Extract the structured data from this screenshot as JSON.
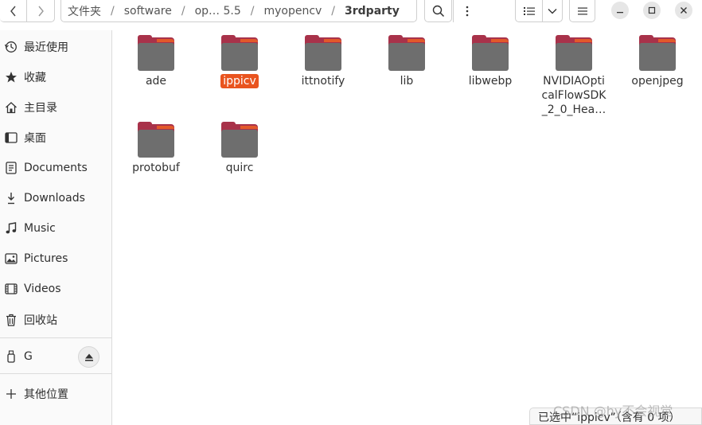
{
  "header": {
    "breadcrumbs": [
      "文件夹",
      "software",
      "op… 5.5",
      "myopencv",
      "3rdparty"
    ]
  },
  "sidebar": {
    "items": [
      {
        "label": "最近使用",
        "icon": "recent-icon"
      },
      {
        "label": "收藏",
        "icon": "star-icon"
      },
      {
        "label": "主目录",
        "icon": "home-icon"
      },
      {
        "label": "桌面",
        "icon": "desktop-icon"
      },
      {
        "label": "Documents",
        "icon": "documents-icon"
      },
      {
        "label": "Downloads",
        "icon": "downloads-icon"
      },
      {
        "label": "Music",
        "icon": "music-icon"
      },
      {
        "label": "Pictures",
        "icon": "pictures-icon"
      },
      {
        "label": "Videos",
        "icon": "videos-icon"
      },
      {
        "label": "回收站",
        "icon": "trash-icon"
      }
    ],
    "drive": {
      "label": "G",
      "icon": "usb-drive-icon"
    },
    "other": {
      "label": "其他位置",
      "icon": "plus-icon"
    }
  },
  "folders": [
    {
      "name": "ade"
    },
    {
      "name": "ippicv",
      "selected": true
    },
    {
      "name": "ittnotify"
    },
    {
      "name": "lib"
    },
    {
      "name": "libwebp"
    },
    {
      "name": "NVIDIAOpticalFlowSDK_2_0_Hea…"
    },
    {
      "name": "openjpeg"
    },
    {
      "name": "protobuf"
    },
    {
      "name": "quirc"
    }
  ],
  "status": {
    "text": "已选中“ippicv”（含有 0 项）"
  },
  "watermark": "CSDN @hy不会视觉",
  "colors": {
    "accent": "#e9541f",
    "folder_back": "#a8324a",
    "folder_front": "#6e6e6e"
  }
}
